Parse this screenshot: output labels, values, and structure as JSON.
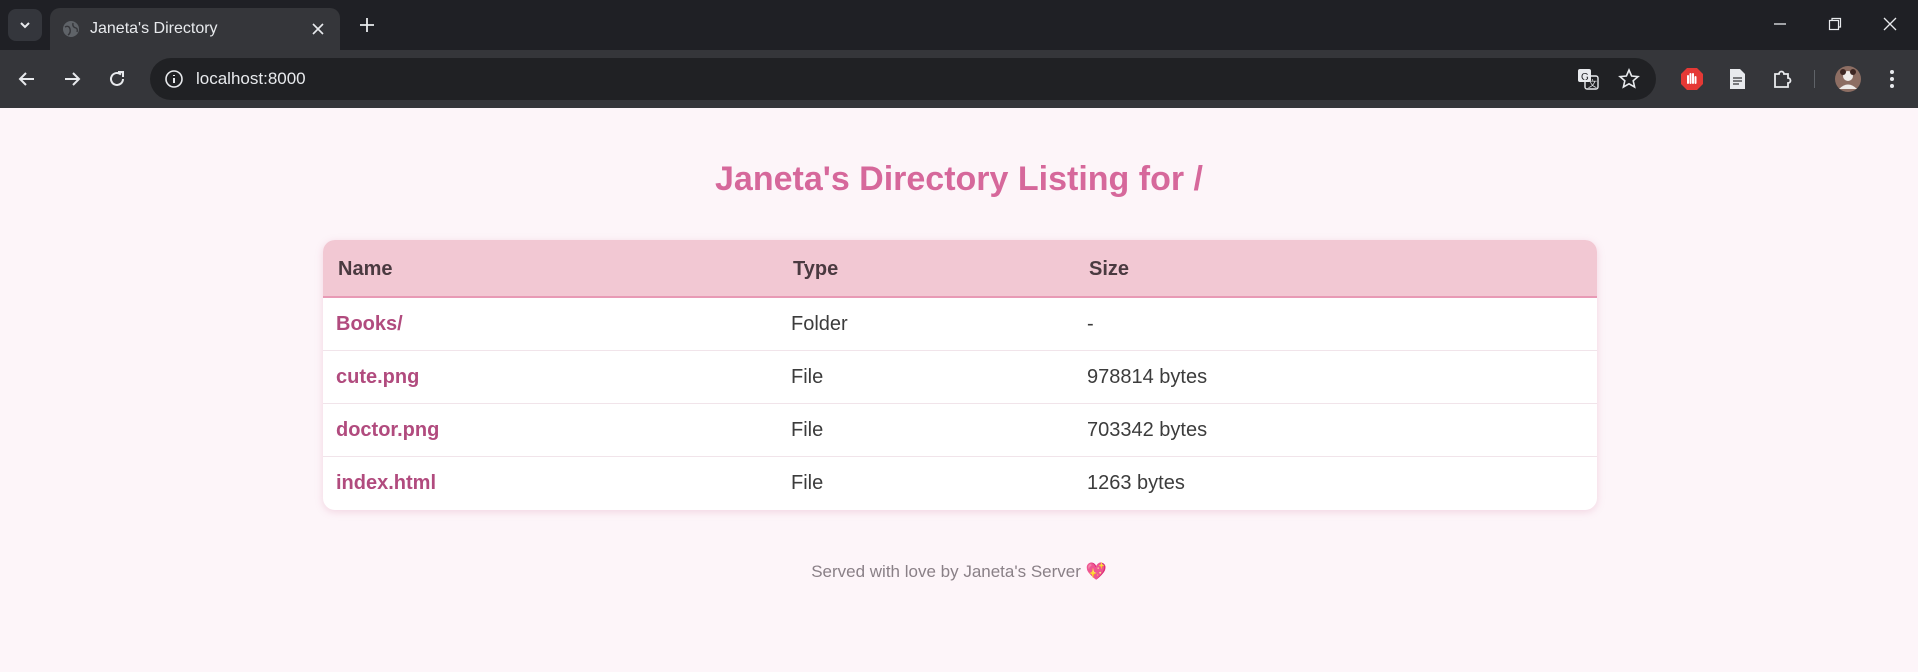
{
  "browser": {
    "tab_title": "Janeta's Directory",
    "url": "localhost:8000",
    "icons": [
      "tab-search-icon",
      "globe-icon",
      "close-icon",
      "plus-icon",
      "back-icon",
      "forward-icon",
      "reload-icon",
      "info-icon",
      "translate-icon",
      "star-icon",
      "adblock-icon",
      "document-icon",
      "extensions-icon",
      "profile-icon",
      "menu-icon",
      "minimize-icon",
      "restore-icon",
      "window-close-icon"
    ]
  },
  "page": {
    "title": "Janeta's Directory Listing for /",
    "columns": [
      "Name",
      "Type",
      "Size"
    ],
    "rows": [
      {
        "name": "Books/",
        "type": "Folder",
        "size": "-"
      },
      {
        "name": "cute.png",
        "type": "File",
        "size": "978814 bytes"
      },
      {
        "name": "doctor.png",
        "type": "File",
        "size": "703342 bytes"
      },
      {
        "name": "index.html",
        "type": "File",
        "size": "1263 bytes"
      }
    ],
    "footer": "Served with love by Janeta's Server",
    "footer_emoji": "💖"
  },
  "colors": {
    "title": "#d6689b",
    "header_bg": "#f2c8d3",
    "link": "#b14b7e",
    "page_bg": "#fdf5f9"
  }
}
